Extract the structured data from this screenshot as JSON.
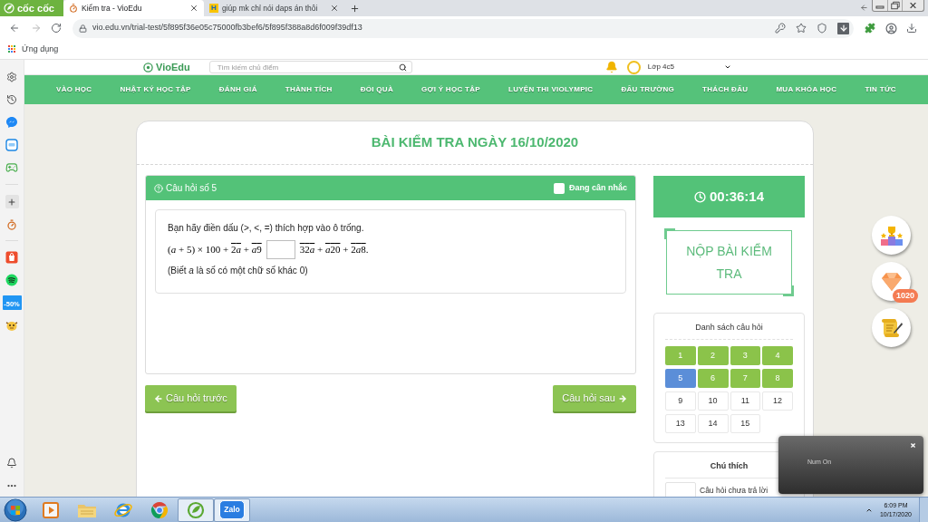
{
  "browser": {
    "brand": "cốc cốc",
    "tabs": [
      {
        "title": "Kiểm tra - VioEdu",
        "selected": true
      },
      {
        "title": "giúp mk chỉ nói daps án thôi",
        "selected": false,
        "favicon_letter": "H"
      }
    ],
    "url": "vio.edu.vn/trial-test/5f895f36e05c75000fb3bef6/5f895f388a8d6f009f39df13",
    "bookmarks": [
      "Ứng dụng"
    ]
  },
  "sidebar": {
    "promo_label": "-50%"
  },
  "site_header": {
    "logo": "VioEdu",
    "search_placeholder": "Tìm kiếm chủ điểm",
    "user_class": "Lớp 4c5"
  },
  "nav": [
    "VÀO HỌC",
    "NHẬT KÝ HỌC TẬP",
    "ĐÁNH GIÁ",
    "THÀNH TÍCH",
    "ĐỔI QUÀ",
    "GỢI Ý HỌC TẬP",
    "LUYỆN THI VIOLYMPIC",
    "ĐẤU TRƯỜNG",
    "THÁCH ĐẤU",
    "MUA KHÓA HỌC",
    "TIN TỨC"
  ],
  "exam": {
    "title": "BÀI KIỂM TRA NGÀY 16/10/2020",
    "question": {
      "heading": "Câu hỏi số 5",
      "flag": {
        "label": "Đang cân nhắc",
        "checked": false
      },
      "prompt": "Bạn hãy điền dấu (>, <, =) thích hợp vào ô trống.",
      "left": [
        {
          "text": "(a + 5) × 100 + ",
          "overline": false
        },
        {
          "text": "2a",
          "overline": true
        },
        {
          "text": " + ",
          "overline": false
        },
        {
          "text": "a9",
          "overline": true
        }
      ],
      "right": [
        {
          "text": "32a",
          "overline": true
        },
        {
          "text": " + ",
          "overline": false
        },
        {
          "text": "a20",
          "overline": true
        },
        {
          "text": " + ",
          "overline": false
        },
        {
          "text": "2a8",
          "overline": true
        },
        {
          "text": ".",
          "overline": false
        }
      ],
      "note": "(Biết *a* là số có một chữ số khác 0)"
    },
    "prev_button": "Câu hỏi trước",
    "next_button": "Câu hỏi sau",
    "timer": "00:36:14",
    "submit_button": "NỘP BÀI KIỂM TRA",
    "question_list": {
      "title": "Danh sách câu hỏi",
      "items": [
        {
          "label": "1",
          "answered": true,
          "selected": false
        },
        {
          "label": "2",
          "answered": true,
          "selected": false
        },
        {
          "label": "3",
          "answered": true,
          "selected": false
        },
        {
          "label": "4",
          "answered": true,
          "selected": false
        },
        {
          "label": "5",
          "selected": true
        },
        {
          "label": "6",
          "answered": true,
          "selected": false
        },
        {
          "label": "7",
          "answered": true,
          "selected": false
        },
        {
          "label": "8",
          "answered": true,
          "selected": false
        },
        {
          "label": "9",
          "answered": false,
          "selected": false
        },
        {
          "label": "10",
          "answered": false,
          "selected": false
        },
        {
          "label": "11",
          "answered": false,
          "selected": false
        },
        {
          "label": "12",
          "answered": false,
          "selected": false
        },
        {
          "label": "13",
          "answered": false,
          "selected": false
        },
        {
          "label": "14",
          "answered": false,
          "selected": false
        },
        {
          "label": "15",
          "answered": false,
          "selected": false
        }
      ]
    },
    "legend": {
      "title": "Chú thích",
      "items": [
        {
          "kind": "unanswered",
          "label": "Câu hỏi chưa trả lời"
        }
      ]
    }
  },
  "rewards": {
    "diamond_count": "1020"
  },
  "notification": {
    "text": "Num On"
  },
  "taskbar": {
    "apps": [
      {
        "kind": "media",
        "active": false
      },
      {
        "kind": "folder",
        "active": false
      },
      {
        "kind": "ie",
        "active": false
      },
      {
        "kind": "chrome",
        "active": false
      },
      {
        "kind": "coccoc",
        "active": true
      },
      {
        "kind": "zalo",
        "active": true,
        "label": "Zalo"
      }
    ],
    "time": "6:09 PM",
    "date": "10/17/2020"
  }
}
